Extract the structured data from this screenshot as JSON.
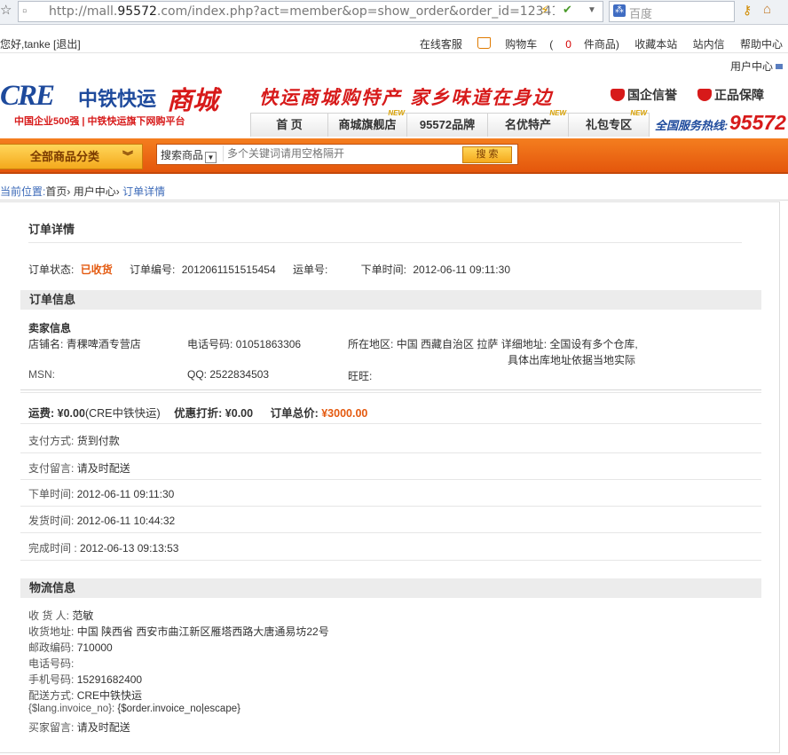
{
  "browser": {
    "url_prefix": "http://mall.",
    "url_domain": "95572",
    "url_rest": ".com/index.php?act=member&op=show_order&order_id=12341",
    "search_engine": "百度"
  },
  "topbar": {
    "greeting": "您好,tanke [退出]",
    "links": {
      "service": "在线客服",
      "cart_label": "购物车",
      "cart_open": "(",
      "cart_count": "0",
      "cart_suffix": "件商品)",
      "favorite": "收藏本站",
      "messages": "站内信",
      "help": "帮助中心"
    },
    "user_center": "用户中心"
  },
  "header": {
    "logo_en": "CRE",
    "logo_cn": "中铁快运",
    "logo_mall": "商城",
    "logo_sub": "中国企业500强  |  中铁快运旗下网购平台",
    "slogan": "快运商城购特产  家乡味道在身边",
    "badge1": "国企信誉",
    "badge2": "正品保障",
    "hotline_label": "全国服务热线:",
    "hotline_number": "95572",
    "new_tag": "NEW"
  },
  "nav": {
    "tabs": [
      {
        "label": "首 页"
      },
      {
        "label": "商城旗舰店"
      },
      {
        "label": "95572品牌"
      },
      {
        "label": "名优特产"
      },
      {
        "label": "礼包专区"
      }
    ]
  },
  "search": {
    "category_button": "全部商品分类",
    "select_label": "搜索商品",
    "placeholder": "多个关键词请用空格隔开",
    "button": "搜 索"
  },
  "breadcrumb": {
    "prefix": "当前位置:",
    "home": "首页",
    "user_center": "用户中心",
    "current": "订单详情",
    "sep": "›"
  },
  "order": {
    "title": "订单详情",
    "status_label": "订单状态:",
    "status_value": "已收货",
    "number_label": "订单编号:",
    "number_value": "2012061151515454",
    "waybill_label": "运单号:",
    "waybill_value": "",
    "time_label": "下单时间:",
    "time_value": "2012-06-11 09:11:30"
  },
  "order_info": {
    "heading": "订单信息",
    "seller_heading": "卖家信息",
    "shop_label": "店铺名:",
    "shop_value": "青稞啤酒专营店",
    "phone_label": "电话号码:",
    "phone_value": "01051863306",
    "region_label": "所在地区:",
    "region_value": "中国 西藏自治区 拉萨",
    "address_label": "详细地址:",
    "address_line1": "全国设有多个仓库,",
    "address_line2": "具体出库地址依据当地实际",
    "msn_label": "MSN:",
    "msn_value": "",
    "qq_label": "QQ:",
    "qq_value": "2522834503",
    "wangwang_label": "旺旺:",
    "wangwang_value": "",
    "shipping_label": "运费:",
    "shipping_value": "¥0.00",
    "shipping_carrier": "(CRE中铁快运)",
    "discount_label": "优惠打折:",
    "discount_value": "¥0.00",
    "total_label": "订单总价:",
    "total_value": "¥3000.00",
    "payment_label": "支付方式:",
    "payment_value": "货到付款",
    "pay_msg_label": "支付留言:",
    "pay_msg_value": "请及时配送",
    "order_time_label": "下单时间:",
    "order_time_value": "2012-06-11 09:11:30",
    "ship_time_label": "发货时间:",
    "ship_time_value": "2012-06-11 10:44:32",
    "finish_time_label": "完成时间 :",
    "finish_time_value": "2012-06-13 09:13:53"
  },
  "logistics": {
    "heading": "物流信息",
    "rows": [
      {
        "label": "收 货 人:",
        "value": "范敏"
      },
      {
        "label": "收货地址:",
        "value": "中国 陕西省 西安市曲江新区雁塔西路大唐通易坊22号"
      },
      {
        "label": "邮政编码:",
        "value": "710000"
      },
      {
        "label": "电话号码:",
        "value": ""
      },
      {
        "label": "手机号码:",
        "value": "15291682400"
      },
      {
        "label": "配送方式:",
        "value": "CRE中铁快运"
      },
      {
        "label": "{$lang.invoice_no}:",
        "value": "{$order.invoice_no|escape}"
      },
      {
        "label": "买家留言:",
        "value": "请及时配送"
      }
    ]
  }
}
